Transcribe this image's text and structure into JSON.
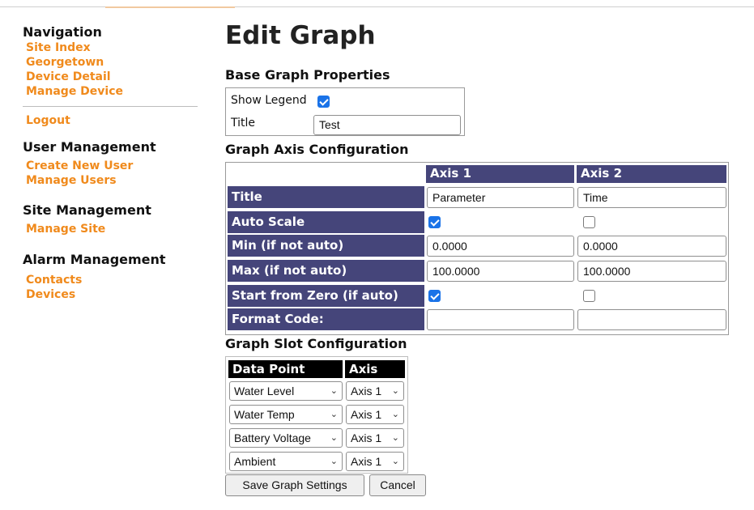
{
  "sidebar": {
    "navigation": {
      "heading": "Navigation",
      "links": [
        "Site Index",
        "Georgetown",
        "Device Detail",
        "Manage Device"
      ]
    },
    "logout": "Logout",
    "user_management": {
      "heading": "User Management",
      "links": [
        "Create New User",
        "Manage Users"
      ]
    },
    "site_management": {
      "heading": "Site Management",
      "links": [
        "Manage Site"
      ]
    },
    "alarm_management": {
      "heading": "Alarm Management",
      "links": [
        "Contacts",
        "Devices"
      ]
    },
    "link_color": "#f08a1c"
  },
  "main": {
    "title": "Edit Graph",
    "base": {
      "heading": "Base Graph Properties",
      "show_legend_label": "Show Legend",
      "show_legend": true,
      "title_label": "Title",
      "title_value": "Test"
    },
    "axis": {
      "heading": "Graph Axis Configuration",
      "header_color": "#45457a",
      "columns": [
        "Axis 1",
        "Axis 2"
      ],
      "rows": {
        "title": "Title",
        "auto_scale": "Auto Scale",
        "min": "Min (if not auto)",
        "max": "Max (if not auto)",
        "start_zero": "Start from Zero (if auto)",
        "format_code": "Format Code:"
      },
      "axis1": {
        "title": "Parameter",
        "auto_scale": true,
        "min": "0.0000",
        "max": "100.0000",
        "start_zero": true,
        "format_code": ""
      },
      "axis2": {
        "title": "Time",
        "auto_scale": false,
        "min": "0.0000",
        "max": "100.0000",
        "start_zero": false,
        "format_code": ""
      }
    },
    "slots": {
      "heading": "Graph Slot Configuration",
      "col_data_point": "Data Point",
      "col_axis": "Axis",
      "rows": [
        {
          "data_point": "Water Level",
          "axis": "Axis 1"
        },
        {
          "data_point": "Water Temp",
          "axis": "Axis 1"
        },
        {
          "data_point": "Battery Voltage",
          "axis": "Axis 1"
        },
        {
          "data_point": "Ambient",
          "axis": "Axis 1"
        }
      ]
    },
    "buttons": {
      "save": "Save Graph Settings",
      "cancel": "Cancel"
    }
  }
}
